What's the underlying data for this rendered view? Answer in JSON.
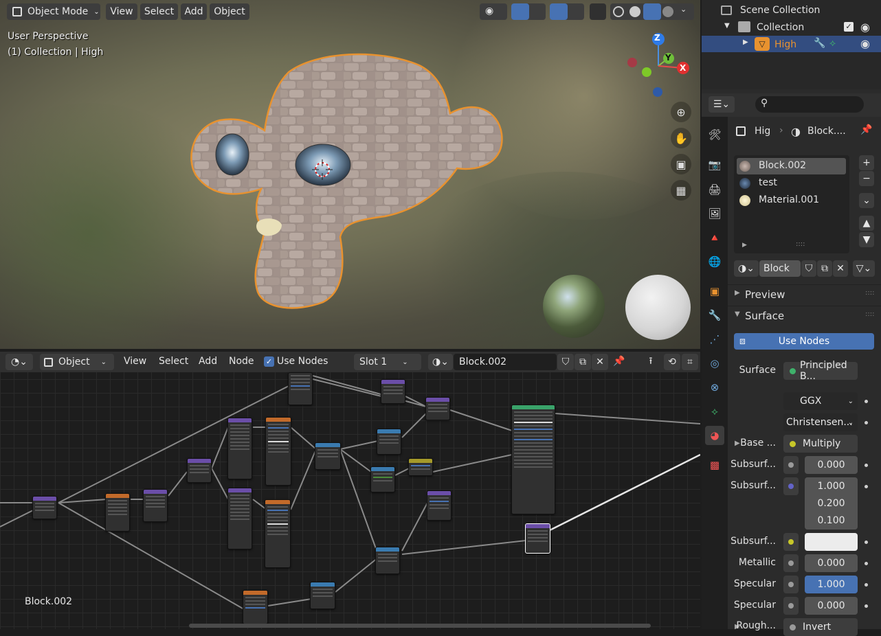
{
  "viewport": {
    "mode": "Object Mode",
    "menu": [
      "View",
      "Select",
      "Add",
      "Object"
    ],
    "perspective": "User Perspective",
    "collection_info": "(1) Collection | High",
    "gizmo": {
      "z": "Z",
      "y": "Y",
      "x": "X"
    }
  },
  "node_editor": {
    "editor_type": "Object",
    "menu": [
      "View",
      "Select",
      "Add",
      "Node"
    ],
    "use_nodes_label": "Use Nodes",
    "slot": "Slot 1",
    "material": "Block.002",
    "footer_material": "Block.002"
  },
  "outliner": {
    "scene_collection": "Scene Collection",
    "collection": "Collection",
    "object": "High"
  },
  "properties": {
    "breadcrumb_object": "Hig",
    "breadcrumb_material": "Block....",
    "materials": [
      "Block.002",
      "test",
      "Material.001"
    ],
    "material_name": "Block",
    "sections": {
      "preview": "Preview",
      "surface": "Surface"
    },
    "use_nodes_button": "Use Nodes",
    "surface_label": "Surface",
    "surface_value": "Principled B...",
    "distribution": "GGX",
    "subsurface_method": "Christensen...",
    "base_color_label": "Base ...",
    "base_color_value": "Multiply",
    "subsurface_label": "Subsurf...",
    "subsurface_value": "0.000",
    "subsurface_radius_label": "Subsurf...",
    "subsurface_radius": [
      "1.000",
      "0.200",
      "0.100"
    ],
    "subsurface_color_label": "Subsurf...",
    "metallic_label": "Metallic",
    "metallic_value": "0.000",
    "specular_label": "Specular",
    "specular_value": "1.000",
    "specular_tint_label": "Specular",
    "specular_tint_value": "0.000",
    "roughness_label": "Rough...",
    "roughness_value": "Invert"
  },
  "colors": {
    "accent_blue": "#4772b3",
    "selection_orange": "#e8922f",
    "header": "#303030"
  }
}
